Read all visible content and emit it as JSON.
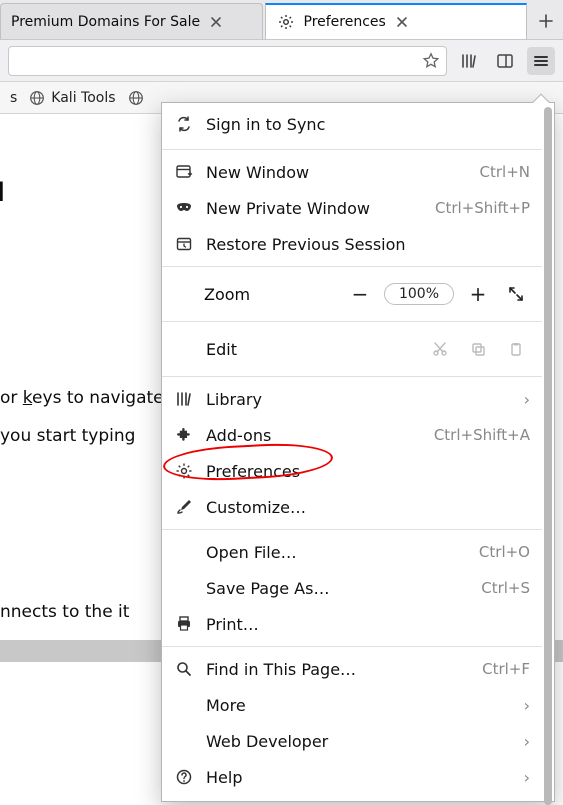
{
  "tabs": {
    "inactive_title": "Premium Domains For Sale",
    "active_title": "Preferences"
  },
  "bookmarks": {
    "left_trunc": "s",
    "kali_tools": "Kali Tools"
  },
  "page": {
    "h_general_trunc": "l",
    "line1": "or keys to navigate",
    "line2": "you start typing",
    "h_network": "",
    "line3": "nnects to the it"
  },
  "menu": {
    "sign_in": "Sign in to Sync",
    "new_window": {
      "label": "New Window",
      "shortcut": "Ctrl+N"
    },
    "new_private": {
      "label": "New Private Window",
      "shortcut": "Ctrl+Shift+P"
    },
    "restore": "Restore Previous Session",
    "zoom": {
      "label": "Zoom",
      "pct": "100%"
    },
    "edit": {
      "label": "Edit"
    },
    "library": "Library",
    "addons": {
      "label": "Add-ons",
      "shortcut": "Ctrl+Shift+A"
    },
    "preferences": "Preferences",
    "customize": "Customize…",
    "open_file": {
      "label": "Open File…",
      "shortcut": "Ctrl+O"
    },
    "save_page": {
      "label": "Save Page As…",
      "shortcut": "Ctrl+S"
    },
    "print": "Print…",
    "find": {
      "label": "Find in This Page…",
      "shortcut": "Ctrl+F"
    },
    "more": "More",
    "web_dev": "Web Developer",
    "help": "Help"
  }
}
